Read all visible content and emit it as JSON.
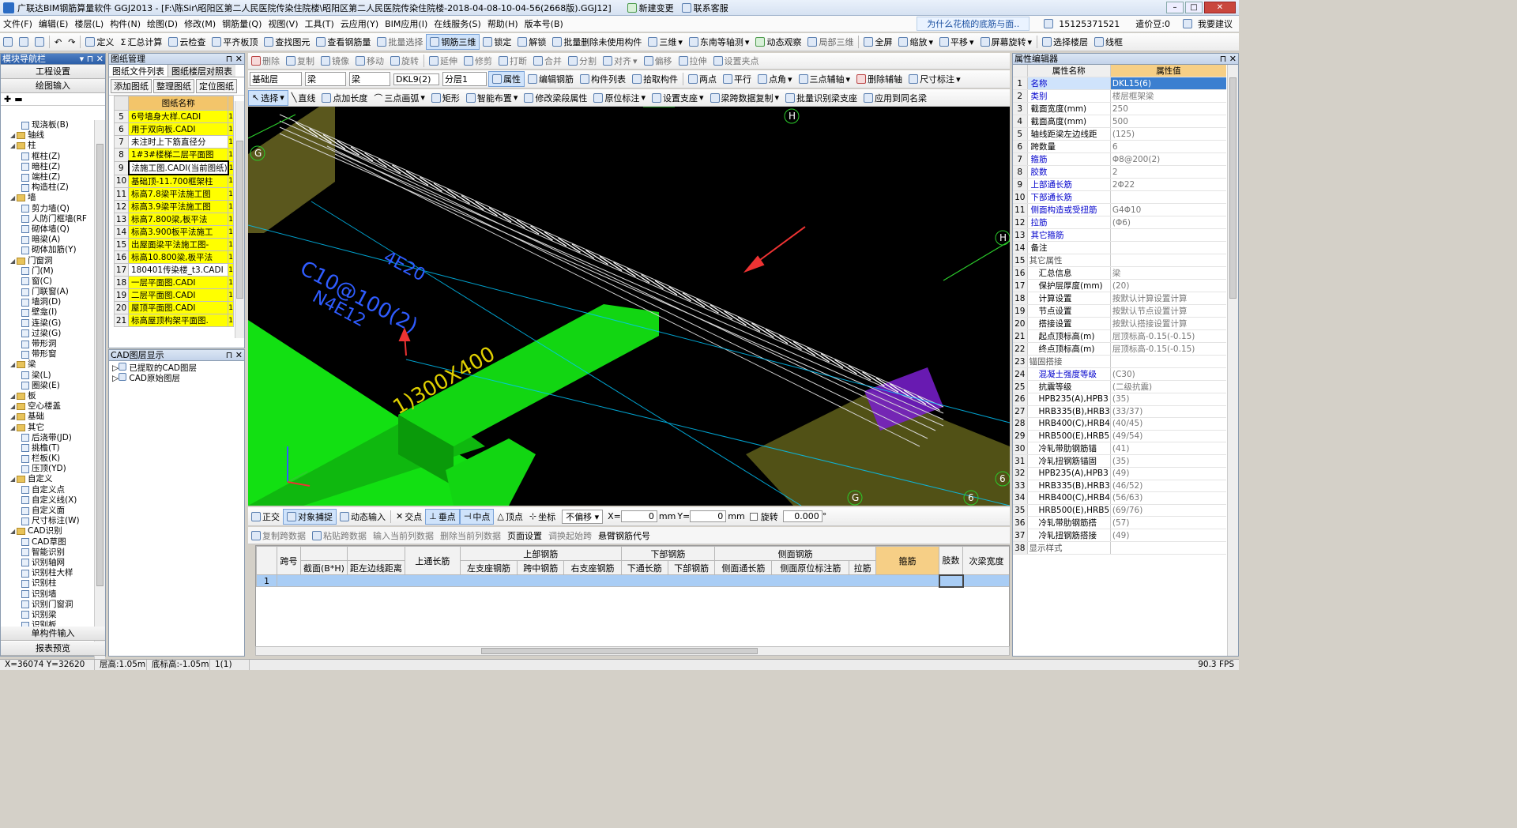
{
  "window": {
    "title": "广联达BIM钢筋算量软件 GGJ2013 - [F:\\陈Sir\\昭阳区第二人民医院传染住院楼\\昭阳区第二人民医院传染住院楼-2018-04-08-10-04-56(2668版).GGJ12]",
    "new_change": "新建变更",
    "service": "联系客服",
    "ad": "为什么花梳的底筋与面..",
    "phone": "15125371521",
    "coins": "遣价豆:0",
    "want_ask": "我要建议"
  },
  "menu": [
    "文件(F)",
    "编辑(E)",
    "楼层(L)",
    "构件(N)",
    "绘图(D)",
    "修改(M)",
    "钢筋量(Q)",
    "视图(V)",
    "工具(T)",
    "云应用(Y)",
    "BIM应用(I)",
    "在线服务(S)",
    "帮助(H)",
    "版本号(B)"
  ],
  "toolbar1": [
    "定义",
    "汇总计算",
    "云检查",
    "平齐板顶",
    "查找图元",
    "查看钢筋量",
    "批量选择",
    "钢筋三维",
    "锁定",
    "解锁",
    "批量删除未使用构件",
    "三维",
    "东南等轴测",
    "动态观察",
    "局部三维",
    "全屏",
    "缩放",
    "平移",
    "屏幕旋转",
    "选择楼层",
    "线框"
  ],
  "toolbar2": [
    "删除",
    "复制",
    "镜像",
    "移动",
    "旋转",
    "延伸",
    "修剪",
    "打断",
    "合并",
    "分割",
    "对齐",
    "偏移",
    "拉伸",
    "设置夹点"
  ],
  "toolbar3": {
    "floor": "基础层",
    "type1": "梁",
    "type2": "梁",
    "member": "DKL9(2)",
    "layer": "分层1",
    "buttons": [
      "属性",
      "编辑钢筋",
      "构件列表",
      "拾取构件",
      "两点",
      "平行",
      "点角",
      "三点辅轴",
      "删除辅轴",
      "尺寸标注"
    ]
  },
  "toolbar4": [
    "选择",
    "直线",
    "点加长度",
    "三点画弧",
    "矩形",
    "智能布置",
    "修改梁段属性",
    "原位标注",
    "设置支座",
    "梁跨数据复制",
    "批量识别梁支座",
    "应用到同名梁"
  ],
  "nav": {
    "title": "模块导航栏",
    "btn1": "工程设置",
    "btn2": "绘图输入",
    "btn3": "单构件输入",
    "btn4": "报表预览",
    "tree": [
      {
        "t": "现浇板(B)",
        "l": 2,
        "k": "i"
      },
      {
        "t": "轴线",
        "l": 1,
        "k": "f"
      },
      {
        "t": "柱",
        "l": 1,
        "k": "f"
      },
      {
        "t": "框柱(Z)",
        "l": 2,
        "k": "i"
      },
      {
        "t": "暗柱(Z)",
        "l": 2,
        "k": "i"
      },
      {
        "t": "端柱(Z)",
        "l": 2,
        "k": "i"
      },
      {
        "t": "构造柱(Z)",
        "l": 2,
        "k": "i"
      },
      {
        "t": "墙",
        "l": 1,
        "k": "f"
      },
      {
        "t": "剪力墙(Q)",
        "l": 2,
        "k": "i"
      },
      {
        "t": "人防门框墙(RF",
        "l": 2,
        "k": "i"
      },
      {
        "t": "砌体墙(Q)",
        "l": 2,
        "k": "i"
      },
      {
        "t": "暗梁(A)",
        "l": 2,
        "k": "i"
      },
      {
        "t": "砌体加筋(Y)",
        "l": 2,
        "k": "i"
      },
      {
        "t": "门窗洞",
        "l": 1,
        "k": "f"
      },
      {
        "t": "门(M)",
        "l": 2,
        "k": "i"
      },
      {
        "t": "窗(C)",
        "l": 2,
        "k": "i"
      },
      {
        "t": "门联窗(A)",
        "l": 2,
        "k": "i"
      },
      {
        "t": "墙洞(D)",
        "l": 2,
        "k": "i"
      },
      {
        "t": "壁龛(I)",
        "l": 2,
        "k": "i"
      },
      {
        "t": "连梁(G)",
        "l": 2,
        "k": "i"
      },
      {
        "t": "过梁(G)",
        "l": 2,
        "k": "i"
      },
      {
        "t": "带形洞",
        "l": 2,
        "k": "i"
      },
      {
        "t": "带形窗",
        "l": 2,
        "k": "i"
      },
      {
        "t": "梁",
        "l": 1,
        "k": "f"
      },
      {
        "t": "梁(L)",
        "l": 2,
        "k": "i"
      },
      {
        "t": "圈梁(E)",
        "l": 2,
        "k": "i"
      },
      {
        "t": "板",
        "l": 1,
        "k": "f"
      },
      {
        "t": "空心楼盖",
        "l": 1,
        "k": "f"
      },
      {
        "t": "基础",
        "l": 1,
        "k": "f"
      },
      {
        "t": "其它",
        "l": 1,
        "k": "f"
      },
      {
        "t": "后浇带(JD)",
        "l": 2,
        "k": "i"
      },
      {
        "t": "挑檐(T)",
        "l": 2,
        "k": "i"
      },
      {
        "t": "栏板(K)",
        "l": 2,
        "k": "i"
      },
      {
        "t": "压顶(YD)",
        "l": 2,
        "k": "i"
      },
      {
        "t": "自定义",
        "l": 1,
        "k": "f"
      },
      {
        "t": "自定义点",
        "l": 2,
        "k": "i"
      },
      {
        "t": "自定义线(X)",
        "l": 2,
        "k": "i"
      },
      {
        "t": "自定义面",
        "l": 2,
        "k": "i"
      },
      {
        "t": "尺寸标注(W)",
        "l": 2,
        "k": "i"
      },
      {
        "t": "CAD识别",
        "l": 1,
        "k": "f"
      },
      {
        "t": "CAD草图",
        "l": 2,
        "k": "i"
      },
      {
        "t": "智能识别",
        "l": 2,
        "k": "i"
      },
      {
        "t": "识别轴网",
        "l": 2,
        "k": "i"
      },
      {
        "t": "识别柱大样",
        "l": 2,
        "k": "i"
      },
      {
        "t": "识别柱",
        "l": 2,
        "k": "i"
      },
      {
        "t": "识别墙",
        "l": 2,
        "k": "i"
      },
      {
        "t": "识别门窗洞",
        "l": 2,
        "k": "i"
      },
      {
        "t": "识别梁",
        "l": 2,
        "k": "i"
      },
      {
        "t": "识别板",
        "l": 2,
        "k": "i"
      }
    ]
  },
  "drawings": {
    "title": "图纸管理",
    "tab1": "图纸文件列表",
    "tab2": "图纸楼层对照表",
    "btn_add": "添加图纸",
    "btn_org": "整理图纸",
    "btn_loc": "定位图纸",
    "col_name": "图纸名称",
    "rows": [
      {
        "n": "5",
        "name": "6号墙身大样.CADI",
        "y": true
      },
      {
        "n": "6",
        "name": "用于双向板.CADI",
        "y": true
      },
      {
        "n": "7",
        "name": "未注时上下筋直径分",
        "y": false
      },
      {
        "n": "8",
        "name": "1#3#楼梯二层平面图",
        "y": true
      },
      {
        "n": "9",
        "name": "法施工图.CADI(当前图纸)",
        "y": false
      },
      {
        "n": "10",
        "name": "基础顶-11.700框架柱",
        "y": true
      },
      {
        "n": "11",
        "name": "标高7.8梁平法施工图",
        "y": true
      },
      {
        "n": "12",
        "name": "标高3.9梁平法施工图",
        "y": true
      },
      {
        "n": "13",
        "name": "标高7.800梁,板平法",
        "y": true
      },
      {
        "n": "14",
        "name": "标高3.900板平法施工",
        "y": true
      },
      {
        "n": "15",
        "name": "出屋面梁平法施工图-",
        "y": true
      },
      {
        "n": "16",
        "name": "标高10.800梁,板平法",
        "y": true
      },
      {
        "n": "17",
        "name": "180401传染楼_t3.CADI",
        "y": false
      },
      {
        "n": "18",
        "name": "一层平面图.CADI",
        "y": true
      },
      {
        "n": "19",
        "name": "二层平面图.CADI",
        "y": true
      },
      {
        "n": "20",
        "name": "屋顶平面图.CADI",
        "y": true
      },
      {
        "n": "21",
        "name": "标高屋顶构架平面图.",
        "y": true
      }
    ]
  },
  "cad_layers": {
    "title": "CAD图层显示",
    "items": [
      "已提取的CAD图层",
      "CAD原始图层"
    ]
  },
  "props": {
    "title": "属性编辑器",
    "col_name": "属性名称",
    "col_val": "属性值",
    "rows": [
      {
        "n": "1",
        "k": "名称",
        "v": "DKL15(6)",
        "b": true
      },
      {
        "n": "2",
        "k": "类别",
        "v": "楼层框架梁",
        "b": true
      },
      {
        "n": "3",
        "k": "截面宽度(mm)",
        "v": "250",
        "b": false
      },
      {
        "n": "4",
        "k": "截面高度(mm)",
        "v": "500",
        "b": false
      },
      {
        "n": "5",
        "k": "轴线距梁左边线距",
        "v": "(125)",
        "b": false
      },
      {
        "n": "6",
        "k": "跨数量",
        "v": "6",
        "b": false
      },
      {
        "n": "7",
        "k": "箍筋",
        "v": "Φ8@200(2)",
        "b": true
      },
      {
        "n": "8",
        "k": "胶数",
        "v": "2",
        "b": true
      },
      {
        "n": "9",
        "k": "上部通长筋",
        "v": "2Φ22",
        "b": true
      },
      {
        "n": "10",
        "k": "下部通长筋",
        "v": "",
        "b": true
      },
      {
        "n": "11",
        "k": "侧面构造或受扭筋",
        "v": "G4Φ10",
        "b": true
      },
      {
        "n": "12",
        "k": "拉筋",
        "v": "(Φ6)",
        "b": true
      },
      {
        "n": "13",
        "k": "其它箍筋",
        "v": "",
        "b": true
      },
      {
        "n": "14",
        "k": "备注",
        "v": "",
        "b": false
      },
      {
        "n": "15",
        "k": "其它属性",
        "v": "",
        "b": false
      },
      {
        "n": "16",
        "k": "汇总信息",
        "v": "梁",
        "b": false
      },
      {
        "n": "17",
        "k": "保护层厚度(mm)",
        "v": "(20)",
        "b": false
      },
      {
        "n": "18",
        "k": "计算设置",
        "v": "按默认计算设置计算",
        "b": false
      },
      {
        "n": "19",
        "k": "节点设置",
        "v": "按默认节点设置计算",
        "b": false
      },
      {
        "n": "20",
        "k": "搭接设置",
        "v": "按默认搭接设置计算",
        "b": false
      },
      {
        "n": "21",
        "k": "起点顶标高(m)",
        "v": "层顶标高-0.15(-0.15)",
        "b": false
      },
      {
        "n": "22",
        "k": "终点顶标高(m)",
        "v": "层顶标高-0.15(-0.15)",
        "b": false
      },
      {
        "n": "23",
        "k": "锚固搭接",
        "v": "",
        "b": false
      },
      {
        "n": "24",
        "k": "混凝土强度等级",
        "v": "(C30)",
        "b": true
      },
      {
        "n": "25",
        "k": "抗震等级",
        "v": "(二级抗震)",
        "b": false
      },
      {
        "n": "26",
        "k": "HPB235(A),HPB3",
        "v": "(35)",
        "b": false
      },
      {
        "n": "27",
        "k": "HRB335(B),HRB3",
        "v": "(33/37)",
        "b": false
      },
      {
        "n": "28",
        "k": "HRB400(C),HRB4",
        "v": "(40/45)",
        "b": false
      },
      {
        "n": "29",
        "k": "HRB500(E),HRB5",
        "v": "(49/54)",
        "b": false
      },
      {
        "n": "30",
        "k": "冷轧带肋钢筋锚",
        "v": "(41)",
        "b": false
      },
      {
        "n": "31",
        "k": "冷轧扭钢筋锚固",
        "v": "(35)",
        "b": false
      },
      {
        "n": "32",
        "k": "HPB235(A),HPB3",
        "v": "(49)",
        "b": false
      },
      {
        "n": "33",
        "k": "HRB335(B),HRB3",
        "v": "(46/52)",
        "b": false
      },
      {
        "n": "34",
        "k": "HRB400(C),HRB4",
        "v": "(56/63)",
        "b": false
      },
      {
        "n": "35",
        "k": "HRB500(E),HRB5",
        "v": "(69/76)",
        "b": false
      },
      {
        "n": "36",
        "k": "冷轧带肋钢筋搭",
        "v": "(57)",
        "b": false
      },
      {
        "n": "37",
        "k": "冷轧扭钢筋搭接",
        "v": "(49)",
        "b": false
      },
      {
        "n": "38",
        "k": "显示样式",
        "v": "",
        "b": false
      }
    ]
  },
  "viewport": {
    "labels": {
      "h1": "H",
      "h2": "H",
      "g1": "G",
      "g2": "G",
      "six1": "6",
      "six2": "6"
    },
    "cad_text1": "C10@100(2)",
    "cad_text2": "4E20",
    "cad_text3": "N4E12",
    "cad_text4": "1)300X400"
  },
  "snapbar": {
    "items": [
      "正交",
      "对象捕捉",
      "动态输入",
      "交点",
      "垂点",
      "中点",
      "顶点",
      "坐标"
    ],
    "offset": "不偏移",
    "x_label": "X=",
    "x": "0",
    "mm1": "mm",
    "y_label": "Y=",
    "y": "0",
    "mm2": "mm",
    "rotate": "旋转",
    "rot_val": "0.000",
    "deg": "°"
  },
  "gridbar": [
    "复制跨数据",
    "粘贴跨数据",
    "输入当前列数据",
    "删除当前列数据",
    "页面设置",
    "调换起始跨",
    "悬臂钢筋代号"
  ],
  "grid": {
    "group_top": "上部钢筋",
    "group_bottom": "下部钢筋",
    "group_side": "侧面钢筋",
    "h_span": "跨号",
    "h_section": "截面(B*H)",
    "h_dist": "距左边线距离",
    "h_top_through": "上通长筋",
    "h_left_seat": "左支座钢筋",
    "h_mid": "跨中钢筋",
    "h_right_seat": "右支座钢筋",
    "h_bottom_through": "下通长筋",
    "h_bottom": "下部钢筋",
    "h_side_through": "侧面通长筋",
    "h_side_orig": "侧面原位标注筋",
    "h_tie": "拉筋",
    "h_stirrup": "箍筋",
    "h_legs": "肢数",
    "h_sub_width": "次梁宽度",
    "row1": "1"
  },
  "status": {
    "coords": "X=36074 Y=32620",
    "floor_h": "层高:1.05m",
    "bottom_elev": "底标高:-1.05m",
    "sel": "1(1)",
    "fps": "90.3 FPS"
  }
}
